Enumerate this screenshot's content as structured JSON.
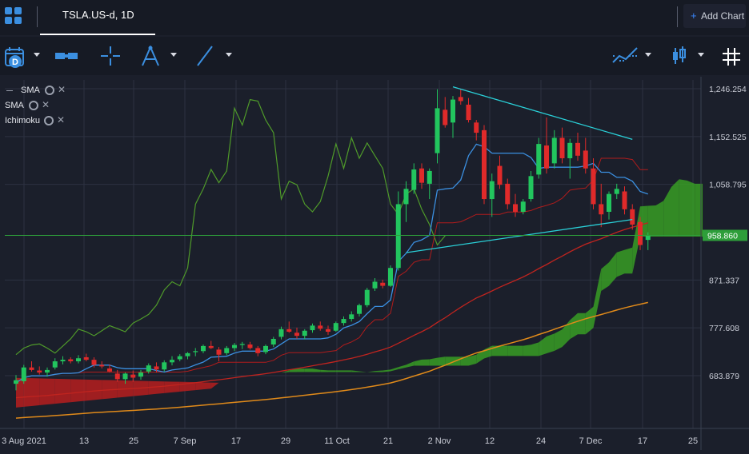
{
  "tab": {
    "title": "TSLA.US-d, 1D"
  },
  "header": {
    "add_chart_label": "Add Chart"
  },
  "toolbar": {
    "icons": [
      "calendar-d-icon",
      "measure-icon",
      "crosshair-icon",
      "fibonacci-icon",
      "trendline-icon",
      "indicators-icon",
      "candlestick-type-icon",
      "grid-icon"
    ]
  },
  "legend": [
    {
      "name": "SMA"
    },
    {
      "name": "SMA"
    },
    {
      "name": "Ichimoku"
    }
  ],
  "colors": {
    "up": "#22c55e",
    "down": "#e02a2a",
    "cloud_bull": "#3aa524",
    "cloud_bear": "#c01e1e",
    "tenkan": "#3b8fe0",
    "kijun": "#b01c1c",
    "sma_fast": "#c0241f",
    "sma_slow": "#e08a1a",
    "lagging": "#4f9a2a",
    "trendline": "#2ad0d8",
    "price_tag": "#2e9e3a"
  },
  "chart_data": {
    "type": "candlestick",
    "symbol": "TSLA.US-d",
    "interval": "1D",
    "ylim": [
      590,
      1260
    ],
    "y_ticks": [
      683.879,
      777.608,
      871.337,
      1058.795,
      1152.525,
      1246.254
    ],
    "y_tick_labels": [
      "683.879",
      "777.608",
      "871.337",
      "1,058.795",
      "1,152.525",
      "1,246.254"
    ],
    "x_tick_labels": [
      "3 Aug 2021",
      "13",
      "25",
      "7 Sep",
      "17",
      "29",
      "11 Oct",
      "21",
      "2 Nov",
      "12",
      "24",
      "7 Dec",
      "17",
      "25"
    ],
    "current_price": 958.86,
    "current_price_label": "958.860",
    "candles": [
      {
        "o": 668,
        "h": 685,
        "l": 655,
        "c": 675
      },
      {
        "o": 673,
        "h": 705,
        "l": 668,
        "c": 700
      },
      {
        "o": 700,
        "h": 712,
        "l": 692,
        "c": 695
      },
      {
        "o": 694,
        "h": 702,
        "l": 686,
        "c": 690
      },
      {
        "o": 690,
        "h": 700,
        "l": 682,
        "c": 695
      },
      {
        "o": 700,
        "h": 718,
        "l": 696,
        "c": 712
      },
      {
        "o": 712,
        "h": 722,
        "l": 706,
        "c": 715
      },
      {
        "o": 716,
        "h": 720,
        "l": 708,
        "c": 712
      },
      {
        "o": 712,
        "h": 724,
        "l": 708,
        "c": 718
      },
      {
        "o": 720,
        "h": 727,
        "l": 712,
        "c": 715
      },
      {
        "o": 715,
        "h": 720,
        "l": 700,
        "c": 705
      },
      {
        "o": 705,
        "h": 712,
        "l": 698,
        "c": 702
      },
      {
        "o": 698,
        "h": 706,
        "l": 690,
        "c": 692
      },
      {
        "o": 688,
        "h": 695,
        "l": 672,
        "c": 677
      },
      {
        "o": 677,
        "h": 690,
        "l": 668,
        "c": 688
      },
      {
        "o": 686,
        "h": 694,
        "l": 672,
        "c": 680
      },
      {
        "o": 682,
        "h": 695,
        "l": 676,
        "c": 690
      },
      {
        "o": 692,
        "h": 708,
        "l": 688,
        "c": 704
      },
      {
        "o": 702,
        "h": 710,
        "l": 690,
        "c": 696
      },
      {
        "o": 696,
        "h": 714,
        "l": 692,
        "c": 710
      },
      {
        "o": 710,
        "h": 722,
        "l": 704,
        "c": 715
      },
      {
        "o": 716,
        "h": 726,
        "l": 712,
        "c": 722
      },
      {
        "o": 722,
        "h": 730,
        "l": 716,
        "c": 728
      },
      {
        "o": 730,
        "h": 738,
        "l": 722,
        "c": 732
      },
      {
        "o": 732,
        "h": 745,
        "l": 728,
        "c": 742
      },
      {
        "o": 742,
        "h": 752,
        "l": 736,
        "c": 738
      },
      {
        "o": 735,
        "h": 740,
        "l": 712,
        "c": 725
      },
      {
        "o": 728,
        "h": 742,
        "l": 724,
        "c": 738
      },
      {
        "o": 738,
        "h": 748,
        "l": 732,
        "c": 744
      },
      {
        "o": 744,
        "h": 750,
        "l": 736,
        "c": 746
      },
      {
        "o": 745,
        "h": 750,
        "l": 735,
        "c": 738
      },
      {
        "o": 738,
        "h": 742,
        "l": 722,
        "c": 728
      },
      {
        "o": 730,
        "h": 745,
        "l": 726,
        "c": 742
      },
      {
        "o": 745,
        "h": 760,
        "l": 740,
        "c": 756
      },
      {
        "o": 760,
        "h": 780,
        "l": 755,
        "c": 775
      },
      {
        "o": 775,
        "h": 790,
        "l": 768,
        "c": 770
      },
      {
        "o": 768,
        "h": 778,
        "l": 756,
        "c": 762
      },
      {
        "o": 762,
        "h": 775,
        "l": 755,
        "c": 772
      },
      {
        "o": 773,
        "h": 786,
        "l": 768,
        "c": 782
      },
      {
        "o": 782,
        "h": 790,
        "l": 772,
        "c": 776
      },
      {
        "o": 775,
        "h": 782,
        "l": 764,
        "c": 770
      },
      {
        "o": 772,
        "h": 790,
        "l": 770,
        "c": 787
      },
      {
        "o": 787,
        "h": 800,
        "l": 782,
        "c": 795
      },
      {
        "o": 795,
        "h": 810,
        "l": 790,
        "c": 804
      },
      {
        "o": 805,
        "h": 825,
        "l": 800,
        "c": 822
      },
      {
        "o": 822,
        "h": 856,
        "l": 818,
        "c": 852
      },
      {
        "o": 855,
        "h": 875,
        "l": 850,
        "c": 868
      },
      {
        "o": 866,
        "h": 872,
        "l": 855,
        "c": 860
      },
      {
        "o": 860,
        "h": 900,
        "l": 858,
        "c": 895
      },
      {
        "o": 895,
        "h": 1045,
        "l": 890,
        "c": 1020
      },
      {
        "o": 1020,
        "h": 1065,
        "l": 985,
        "c": 1050
      },
      {
        "o": 1048,
        "h": 1100,
        "l": 1040,
        "c": 1088
      },
      {
        "o": 1090,
        "h": 1100,
        "l": 1050,
        "c": 1062
      },
      {
        "o": 1060,
        "h": 1090,
        "l": 1030,
        "c": 1085
      },
      {
        "o": 1120,
        "h": 1245,
        "l": 1100,
        "c": 1208
      },
      {
        "o": 1205,
        "h": 1230,
        "l": 1170,
        "c": 1175
      },
      {
        "o": 1180,
        "h": 1232,
        "l": 1150,
        "c": 1225
      },
      {
        "o": 1230,
        "h": 1245,
        "l": 1215,
        "c": 1222
      },
      {
        "o": 1215,
        "h": 1228,
        "l": 1180,
        "c": 1185
      },
      {
        "o": 1180,
        "h": 1185,
        "l": 1145,
        "c": 1160
      },
      {
        "o": 1165,
        "h": 1175,
        "l": 1020,
        "c": 1030
      },
      {
        "o": 1030,
        "h": 1080,
        "l": 995,
        "c": 1065
      },
      {
        "o": 1095,
        "h": 1115,
        "l": 1050,
        "c": 1058
      },
      {
        "o": 1060,
        "h": 1070,
        "l": 1010,
        "c": 1020
      },
      {
        "o": 1020,
        "h": 1040,
        "l": 995,
        "c": 1005
      },
      {
        "o": 1005,
        "h": 1030,
        "l": 1000,
        "c": 1025
      },
      {
        "o": 1030,
        "h": 1085,
        "l": 1025,
        "c": 1075
      },
      {
        "o": 1078,
        "h": 1150,
        "l": 1070,
        "c": 1138
      },
      {
        "o": 1135,
        "h": 1190,
        "l": 1080,
        "c": 1090
      },
      {
        "o": 1100,
        "h": 1165,
        "l": 1090,
        "c": 1150
      },
      {
        "o": 1150,
        "h": 1170,
        "l": 1100,
        "c": 1110
      },
      {
        "o": 1110,
        "h": 1148,
        "l": 1070,
        "c": 1140
      },
      {
        "o": 1140,
        "h": 1160,
        "l": 1105,
        "c": 1115
      },
      {
        "o": 1125,
        "h": 1150,
        "l": 1080,
        "c": 1090
      },
      {
        "o": 1090,
        "h": 1110,
        "l": 1010,
        "c": 1020
      },
      {
        "o": 1020,
        "h": 1060,
        "l": 975,
        "c": 1000
      },
      {
        "o": 1005,
        "h": 1045,
        "l": 990,
        "c": 1040
      },
      {
        "o": 1040,
        "h": 1060,
        "l": 1030,
        "c": 1050
      },
      {
        "o": 1045,
        "h": 1055,
        "l": 1000,
        "c": 1010
      },
      {
        "o": 1010,
        "h": 1020,
        "l": 970,
        "c": 980
      },
      {
        "o": 985,
        "h": 995,
        "l": 930,
        "c": 940
      },
      {
        "o": 950,
        "h": 965,
        "l": 930,
        "c": 958
      }
    ]
  }
}
